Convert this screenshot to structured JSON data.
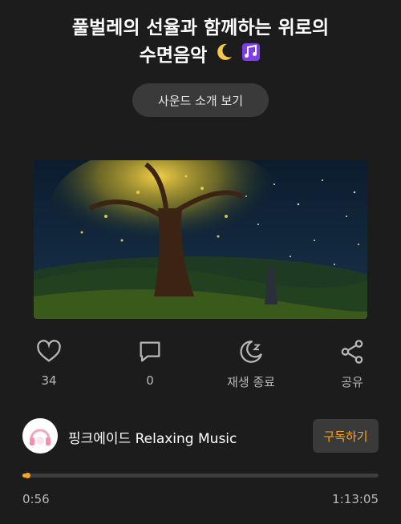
{
  "track": {
    "title_line1": "풀벌레의 선율과 함께하는 위로의",
    "title_line2": "수면음악",
    "title_icons": [
      "crescent-moon",
      "music-notes"
    ]
  },
  "intro_button": "사운드 소개 보기",
  "actions": [
    {
      "icon": "heart-icon",
      "label": "34"
    },
    {
      "icon": "comment-icon",
      "label": "0"
    },
    {
      "icon": "sleep-timer-icon",
      "label": "재생 종료"
    },
    {
      "icon": "share-icon",
      "label": "공유"
    }
  ],
  "channel": {
    "name": "핑크에이드 Relaxing Music",
    "subscribe_label": "구독하기"
  },
  "player": {
    "elapsed": "0:56",
    "duration": "1:13:05",
    "progress_fraction": 0.0128
  },
  "colors": {
    "background": "#1c1c1c",
    "accent": "#f5a623",
    "button_bg": "#3a3a3a",
    "muted_text": "#b8b8b8"
  }
}
